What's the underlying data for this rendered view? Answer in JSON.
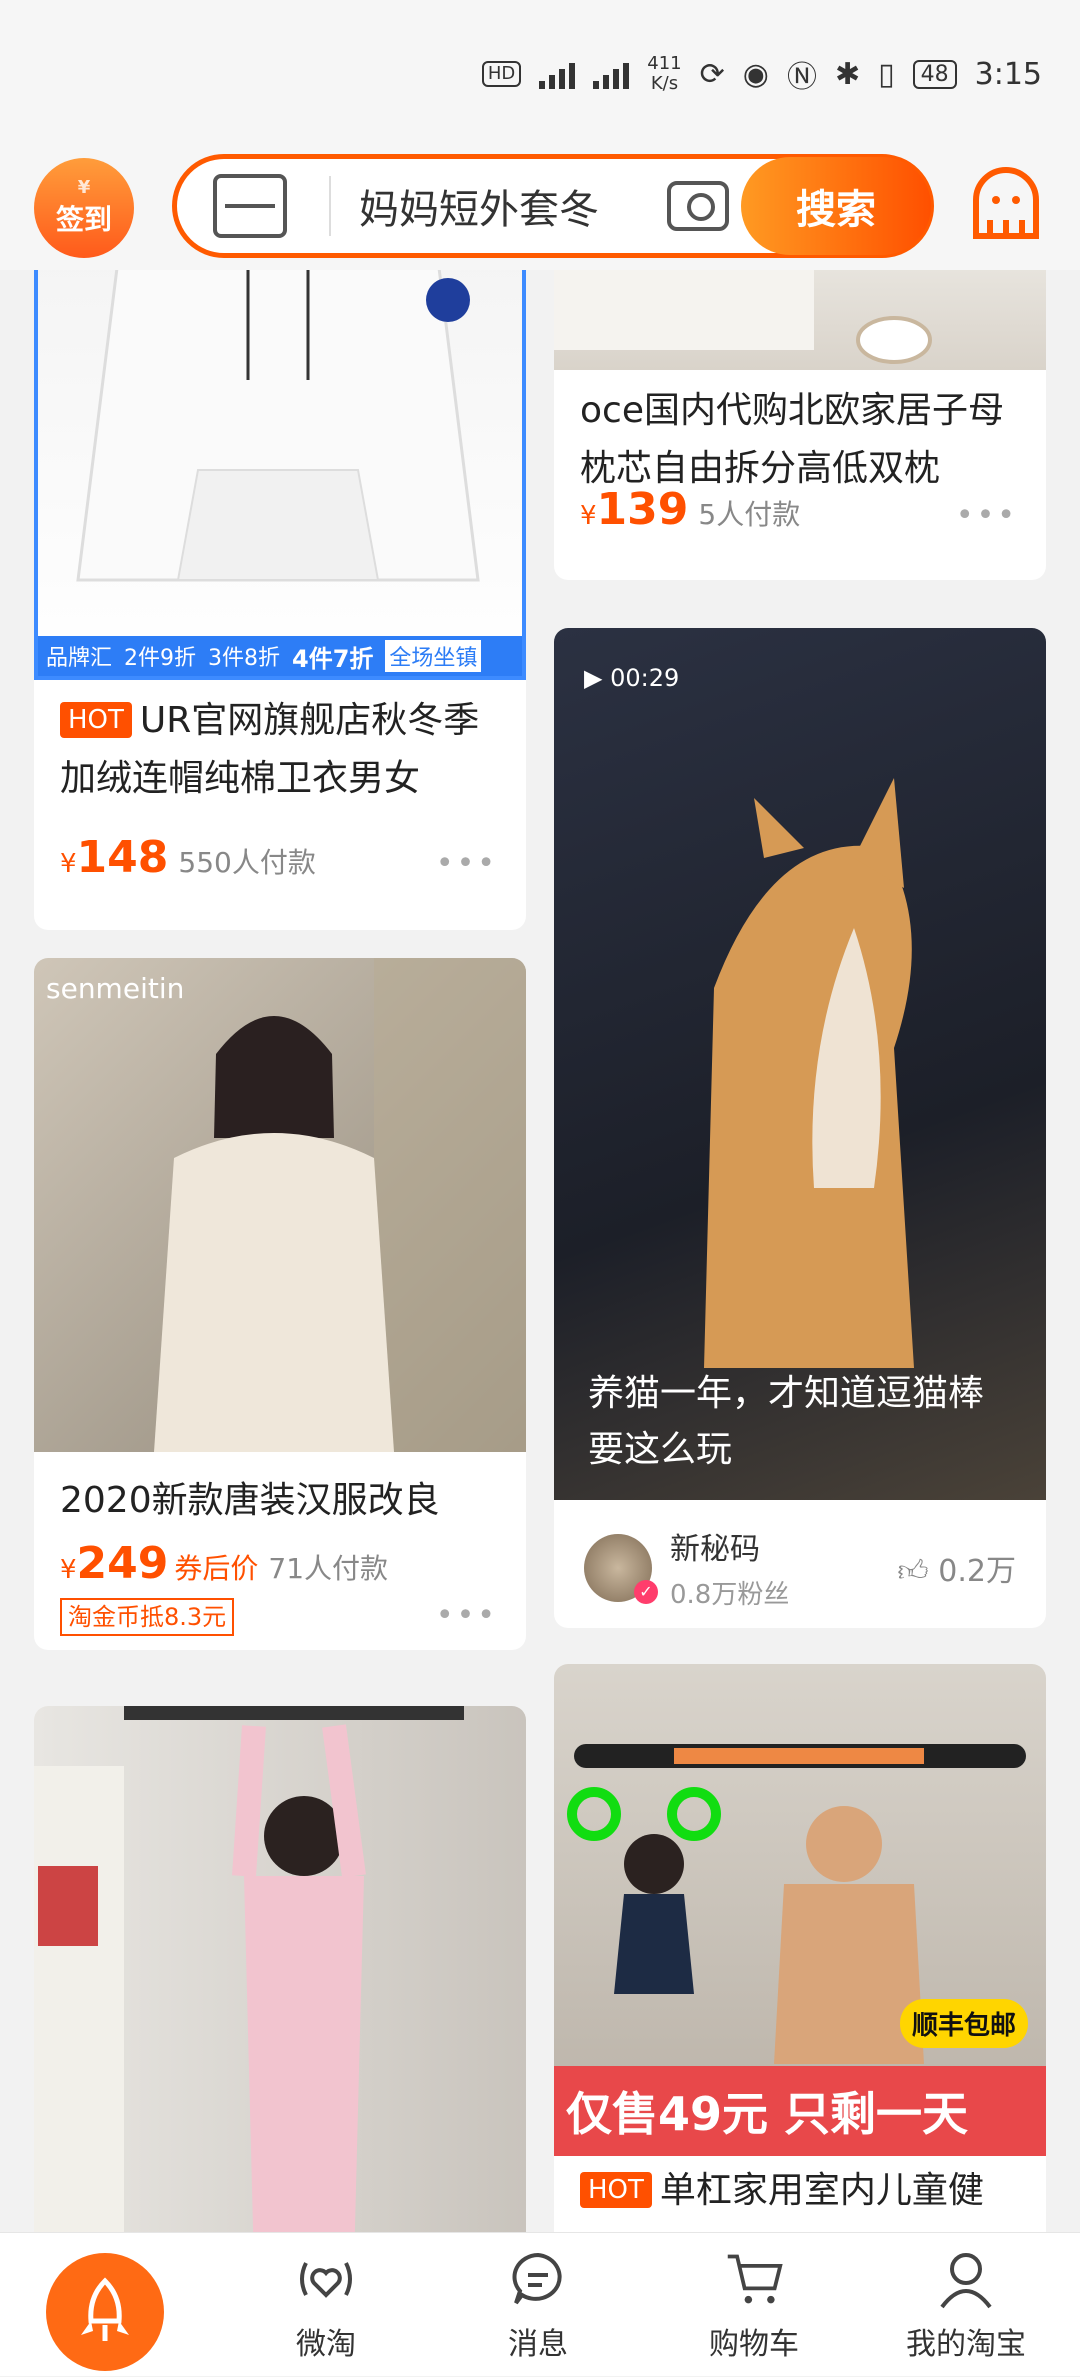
{
  "status_bar": {
    "net_speed": "411",
    "net_unit": "K/s",
    "battery": "48",
    "time": "3:15"
  },
  "header": {
    "signin_label": "签到",
    "search_placeholder": "妈妈短外套冬",
    "search_button": "搜索"
  },
  "feed": {
    "left": [
      {
        "title": "UR官网旗舰店秋冬季加绒连帽纯棉卫衣男女",
        "hot": "HOT",
        "price": "148",
        "buyers": "550人付款",
        "promo": [
          "品牌汇",
          "2件9折",
          "3件8折",
          "4件7折",
          "全场坐镇"
        ]
      },
      {
        "brand": "senmeitin",
        "title": "2020新款唐装汉服改良",
        "price": "249",
        "coupon": "券后价",
        "buyers": "71人付款",
        "tb_coin": "淘金币抵8.3元"
      }
    ],
    "right": [
      {
        "title": "oce国内代购北欧家居子母枕芯自由拆分高低双枕",
        "price": "139",
        "buyers": "5人付款"
      },
      {
        "video_time": "00:29",
        "caption": "养猫一年，才知道逗猫棒要这么玩",
        "author": "新秘码",
        "fans": "0.8万粉丝",
        "likes": "0.2万"
      },
      {
        "hot": "HOT",
        "title": "单杠家用室内儿童健",
        "banner": "仅售49元 只剩一天",
        "sf_badge": "顺丰包邮"
      }
    ],
    "currency": "¥",
    "more": "•••"
  },
  "tabbar": [
    {
      "label": "微淘"
    },
    {
      "label": "消息"
    },
    {
      "label": "购物车"
    },
    {
      "label": "我的淘宝"
    }
  ]
}
